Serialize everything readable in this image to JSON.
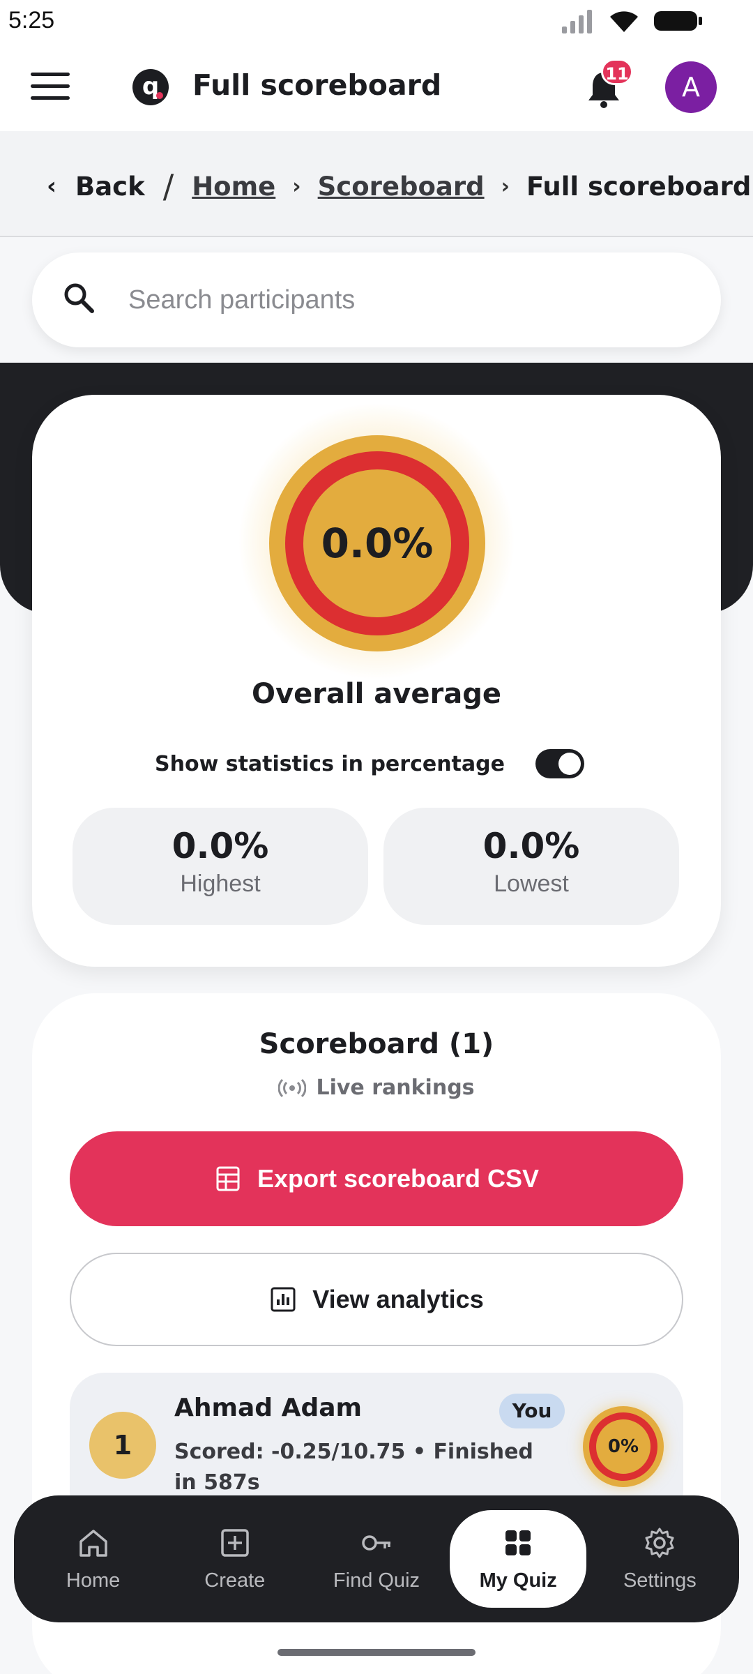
{
  "status_bar": {
    "time": "5:25"
  },
  "app_bar": {
    "title": "Full scoreboard",
    "notification_count": "11",
    "avatar_initial": "A"
  },
  "breadcrumb": {
    "back": "Back",
    "home": "Home",
    "scoreboard": "Scoreboard",
    "current": "Full scoreboard"
  },
  "search": {
    "placeholder": "Search participants"
  },
  "stats": {
    "overall_value": "0.0%",
    "overall_label": "Overall average",
    "percentage_toggle_label": "Show statistics in percentage",
    "percentage_toggle_on": true,
    "highest_value": "0.0%",
    "highest_label": "Highest",
    "lowest_value": "0.0%",
    "lowest_label": "Lowest"
  },
  "scoreboard": {
    "title": "Scoreboard (1)",
    "live_label": "Live rankings",
    "export_label": "Export scoreboard CSV",
    "analytics_label": "View analytics",
    "entries": [
      {
        "rank": "1",
        "name": "Ahmad Adam",
        "badge": "You",
        "detail": "Scored: -0.25/10.75 • Finished in 587s",
        "score": "0%"
      }
    ]
  },
  "bottom_nav": {
    "items": [
      {
        "label": "Home",
        "icon": "home-icon"
      },
      {
        "label": "Create",
        "icon": "plus-square-icon"
      },
      {
        "label": "Find Quiz",
        "icon": "key-icon"
      },
      {
        "label": "My Quiz",
        "icon": "grid-icon",
        "active": true
      },
      {
        "label": "Settings",
        "icon": "gear-icon"
      }
    ]
  },
  "colors": {
    "accent": "#e3335a",
    "dark": "#1f2024",
    "gold": "#e3ac3e",
    "ring_red": "#dc2f31",
    "avatar": "#7b1fa2"
  }
}
